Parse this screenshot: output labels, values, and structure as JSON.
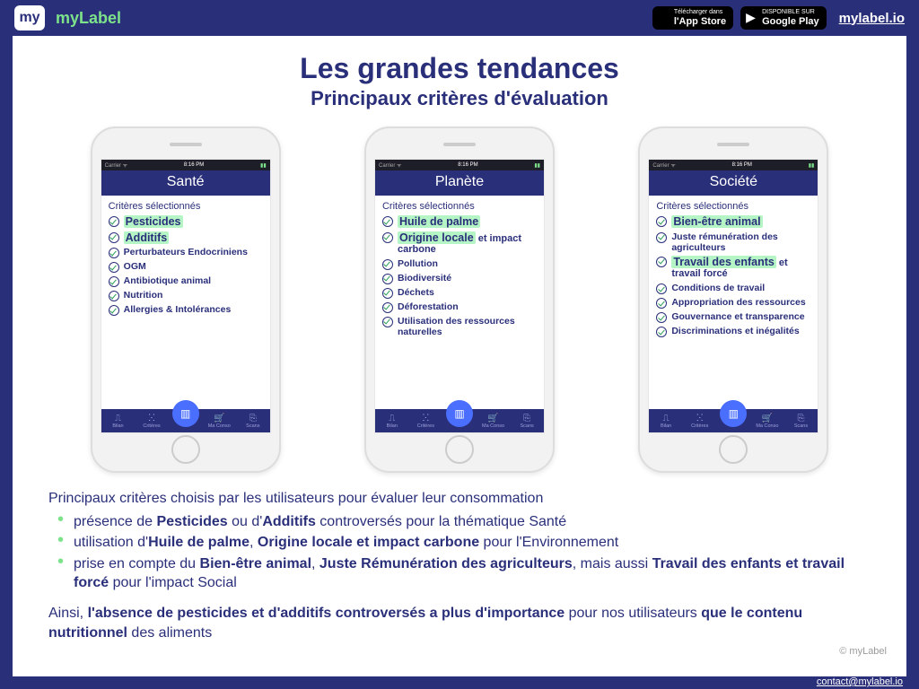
{
  "header": {
    "logo_text": "my",
    "brand": "myLabel",
    "appstore_small": "Télécharger dans",
    "appstore_big": "l'App Store",
    "gplay_small": "DISPONIBLE SUR",
    "gplay_big": "Google Play",
    "site_link": "mylabel.io"
  },
  "title": "Les grandes tendances",
  "subtitle": "Principaux critères d'évaluation",
  "status": {
    "left": "Carrier ᯤ",
    "center": "8:16 PM",
    "right": "▮▮"
  },
  "tabs": [
    "Bilan",
    "Critères",
    "Scan",
    "Ma Conso",
    "Scans"
  ],
  "phones": [
    {
      "title": "Santé",
      "subtitle": "Critères sélectionnés",
      "items": [
        {
          "hi": true,
          "pre": "",
          "hl": "Pesticides",
          "post": ""
        },
        {
          "hi": true,
          "pre": "",
          "hl": "Additifs",
          "post": ""
        },
        {
          "hi": false,
          "txt": "Perturbateurs Endocriniens"
        },
        {
          "hi": false,
          "txt": "OGM"
        },
        {
          "hi": false,
          "txt": "Antibiotique animal"
        },
        {
          "hi": false,
          "txt": "Nutrition"
        },
        {
          "hi": false,
          "txt": "Allergies & Intolérances"
        }
      ]
    },
    {
      "title": "Planète",
      "subtitle": "Critères sélectionnés",
      "items": [
        {
          "hi": true,
          "pre": "",
          "hl": "Huile de palme",
          "post": ""
        },
        {
          "hi": true,
          "pre": "",
          "hl": "Origine locale",
          "post": " et impact carbone"
        },
        {
          "hi": false,
          "txt": "Pollution"
        },
        {
          "hi": false,
          "txt": "Biodiversité"
        },
        {
          "hi": false,
          "txt": "Déchets"
        },
        {
          "hi": false,
          "txt": "Déforestation"
        },
        {
          "hi": false,
          "txt": "Utilisation des ressources naturelles"
        }
      ]
    },
    {
      "title": "Société",
      "subtitle": "Critères sélectionnés",
      "items": [
        {
          "hi": true,
          "pre": "",
          "hl": "Bien-être animal",
          "post": ""
        },
        {
          "hi": false,
          "txt": "Juste rémunération des agriculteurs"
        },
        {
          "hi": true,
          "pre": "",
          "hl": "Travail des enfants",
          "post": " et travail forcé"
        },
        {
          "hi": false,
          "txt": "Conditions de travail"
        },
        {
          "hi": false,
          "txt": "Appropriation des ressources"
        },
        {
          "hi": false,
          "txt": "Gouvernance et transparence"
        },
        {
          "hi": false,
          "txt": "Discriminations et inégalités"
        }
      ]
    }
  ],
  "body": {
    "lead": "Principaux critères choisis par les utilisateurs pour évaluer leur consommation",
    "b1_a": "présence de ",
    "b1_b": "Pesticides",
    "b1_c": " ou d'",
    "b1_d": "Additifs",
    "b1_e": " controversés pour la thématique Santé",
    "b2_a": "utilisation d'",
    "b2_b": "Huile de palme",
    "b2_c": ", ",
    "b2_d": "Origine locale et impact carbone",
    "b2_e": " pour l'Environnement",
    "b3_a": "prise en compte du ",
    "b3_b": "Bien-être animal",
    "b3_c": ", ",
    "b3_d": "Juste Rémunération des agriculteurs",
    "b3_e": ", mais aussi ",
    "b3_f": "Travail des enfants et travail forcé",
    "b3_g": " pour l'impact Social",
    "p2_a": "Ainsi, ",
    "p2_b": "l'absence de pesticides et d'additifs controversés a plus d'importance",
    "p2_c": " pour nos utilisateurs ",
    "p2_d": "que le contenu nutritionnel",
    "p2_e": " des aliments"
  },
  "footer": {
    "copy": "© myLabel",
    "contact": "contact@mylabel.io"
  }
}
